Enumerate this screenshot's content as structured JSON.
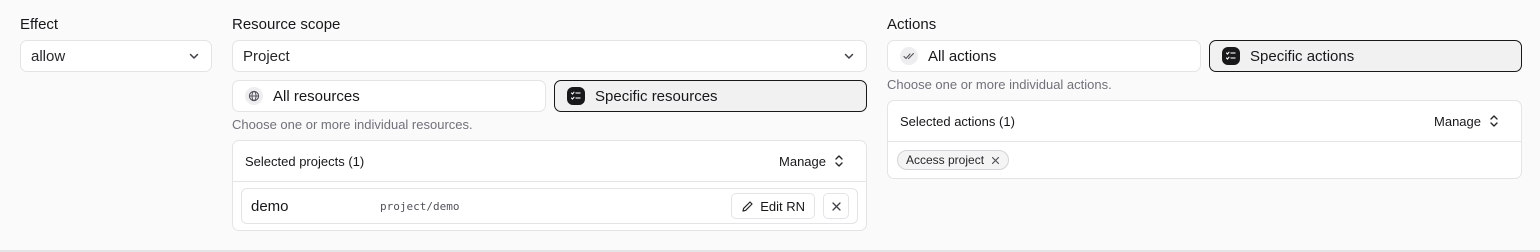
{
  "effect": {
    "label": "Effect",
    "value": "allow"
  },
  "resource_scope": {
    "label": "Resource scope",
    "value": "Project",
    "toggle_all": "All resources",
    "toggle_specific": "Specific resources",
    "active": "specific",
    "hint": "Choose one or more individual resources.",
    "panel_title": "Selected projects (1)",
    "manage_label": "Manage",
    "items": [
      {
        "name": "demo",
        "rn": "project/demo",
        "edit_label": "Edit RN"
      }
    ]
  },
  "actions": {
    "label": "Actions",
    "toggle_all": "All actions",
    "toggle_specific": "Specific actions",
    "active": "specific",
    "hint": "Choose one or more individual actions.",
    "panel_title": "Selected actions (1)",
    "manage_label": "Manage",
    "chips": [
      "Access project"
    ]
  },
  "colors": {
    "background": "#fafafa",
    "border": "#e4e4e7",
    "active_border": "#18181b",
    "muted_text": "#71717a"
  }
}
